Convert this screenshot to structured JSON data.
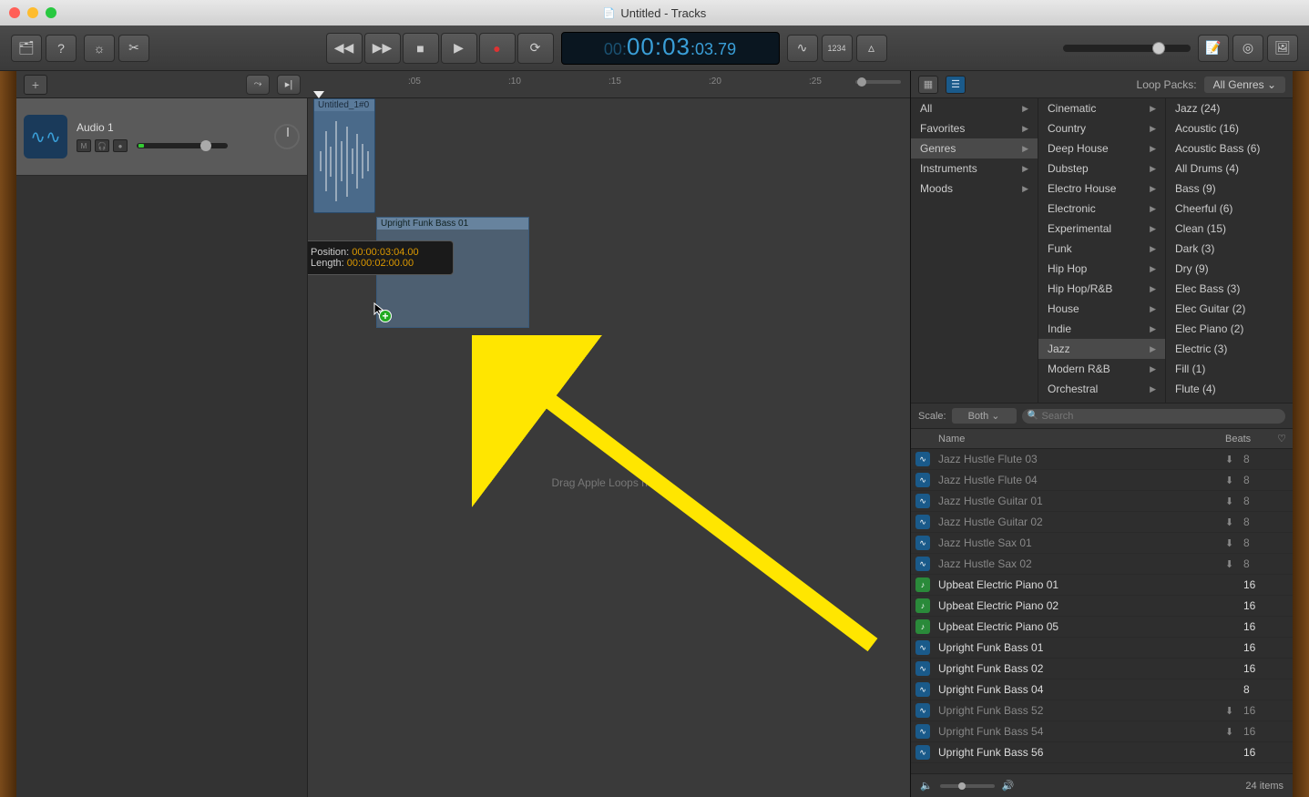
{
  "window": {
    "title": "Untitled - Tracks"
  },
  "lcd": {
    "prefix": "00:",
    "main": "00:03",
    "sub": ":03.79"
  },
  "toolbar": {
    "mode_label": "1234"
  },
  "track_header": {
    "add_label": "+"
  },
  "ruler": {
    "t05": ":05",
    "t10": ":10",
    "t15": ":15",
    "t20": ":20",
    "t25": ":25"
  },
  "tracks": [
    {
      "name": "Audio 1"
    }
  ],
  "region1": {
    "label": "Untitled_1#0"
  },
  "drag_region": {
    "label": "Upright Funk Bass 01"
  },
  "tooltip": {
    "pos_label": "Position:",
    "pos_value": "00:00:03:04.00",
    "len_label": "Length:",
    "len_value": "00:00:02:00.00"
  },
  "drop_hint": "Drag Apple Loops here.",
  "browser": {
    "loop_packs_label": "Loop Packs:",
    "loop_packs_value": "All Genres",
    "scale_label": "Scale:",
    "scale_value": "Both",
    "search_placeholder": "Search",
    "col_name": "Name",
    "col_beats": "Beats",
    "footer_items": "24 items",
    "cat1": [
      {
        "label": "All",
        "sel": false,
        "chev": true
      },
      {
        "label": "Favorites",
        "sel": false,
        "chev": true
      },
      {
        "label": "Genres",
        "sel": true,
        "chev": true
      },
      {
        "label": "Instruments",
        "sel": false,
        "chev": true
      },
      {
        "label": "Moods",
        "sel": false,
        "chev": true
      }
    ],
    "cat2": [
      {
        "label": "Cinematic",
        "chev": true
      },
      {
        "label": "Country",
        "chev": true
      },
      {
        "label": "Deep House",
        "chev": true
      },
      {
        "label": "Dubstep",
        "chev": true
      },
      {
        "label": "Electro House",
        "chev": true
      },
      {
        "label": "Electronic",
        "chev": true
      },
      {
        "label": "Experimental",
        "chev": true
      },
      {
        "label": "Funk",
        "chev": true
      },
      {
        "label": "Hip Hop",
        "chev": true
      },
      {
        "label": "Hip Hop/R&B",
        "chev": true
      },
      {
        "label": "House",
        "chev": true
      },
      {
        "label": "Indie",
        "chev": true
      },
      {
        "label": "Jazz",
        "sel": true,
        "chev": true
      },
      {
        "label": "Modern R&B",
        "chev": true
      },
      {
        "label": "Orchestral",
        "chev": true
      }
    ],
    "cat3": [
      {
        "label": "Jazz (24)"
      },
      {
        "label": "Acoustic (16)"
      },
      {
        "label": "Acoustic Bass (6)"
      },
      {
        "label": "All Drums (4)"
      },
      {
        "label": "Bass (9)"
      },
      {
        "label": "Cheerful (6)"
      },
      {
        "label": "Clean (15)"
      },
      {
        "label": "Dark (3)"
      },
      {
        "label": "Dry (9)"
      },
      {
        "label": "Elec Bass (3)"
      },
      {
        "label": "Elec Guitar (2)"
      },
      {
        "label": "Elec Piano (2)"
      },
      {
        "label": "Electric (3)"
      },
      {
        "label": "Fill (1)"
      },
      {
        "label": "Flute (4)"
      }
    ],
    "loops": [
      {
        "name": "Jazz Hustle Flute 03",
        "beats": "8",
        "dim": true,
        "icon": "blue",
        "dl": true
      },
      {
        "name": "Jazz Hustle Flute 04",
        "beats": "8",
        "dim": true,
        "icon": "blue",
        "dl": true
      },
      {
        "name": "Jazz Hustle Guitar 01",
        "beats": "8",
        "dim": true,
        "icon": "blue",
        "dl": true
      },
      {
        "name": "Jazz Hustle Guitar 02",
        "beats": "8",
        "dim": true,
        "icon": "blue",
        "dl": true
      },
      {
        "name": "Jazz Hustle Sax 01",
        "beats": "8",
        "dim": true,
        "icon": "blue",
        "dl": true
      },
      {
        "name": "Jazz Hustle Sax 02",
        "beats": "8",
        "dim": true,
        "icon": "blue",
        "dl": true
      },
      {
        "name": "Upbeat Electric Piano 01",
        "beats": "16",
        "dim": false,
        "icon": "green",
        "dl": false
      },
      {
        "name": "Upbeat Electric Piano 02",
        "beats": "16",
        "dim": false,
        "icon": "green",
        "dl": false
      },
      {
        "name": "Upbeat Electric Piano 05",
        "beats": "16",
        "dim": false,
        "icon": "green",
        "dl": false
      },
      {
        "name": "Upright Funk Bass 01",
        "beats": "16",
        "dim": false,
        "icon": "blue",
        "dl": false
      },
      {
        "name": "Upright Funk Bass 02",
        "beats": "16",
        "dim": false,
        "icon": "blue",
        "dl": false
      },
      {
        "name": "Upright Funk Bass 04",
        "beats": "8",
        "dim": false,
        "icon": "blue",
        "dl": false
      },
      {
        "name": "Upright Funk Bass 52",
        "beats": "16",
        "dim": true,
        "icon": "blue",
        "dl": true
      },
      {
        "name": "Upright Funk Bass 54",
        "beats": "16",
        "dim": true,
        "icon": "blue",
        "dl": true
      },
      {
        "name": "Upright Funk Bass 56",
        "beats": "16",
        "dim": false,
        "icon": "blue",
        "dl": false
      }
    ]
  }
}
